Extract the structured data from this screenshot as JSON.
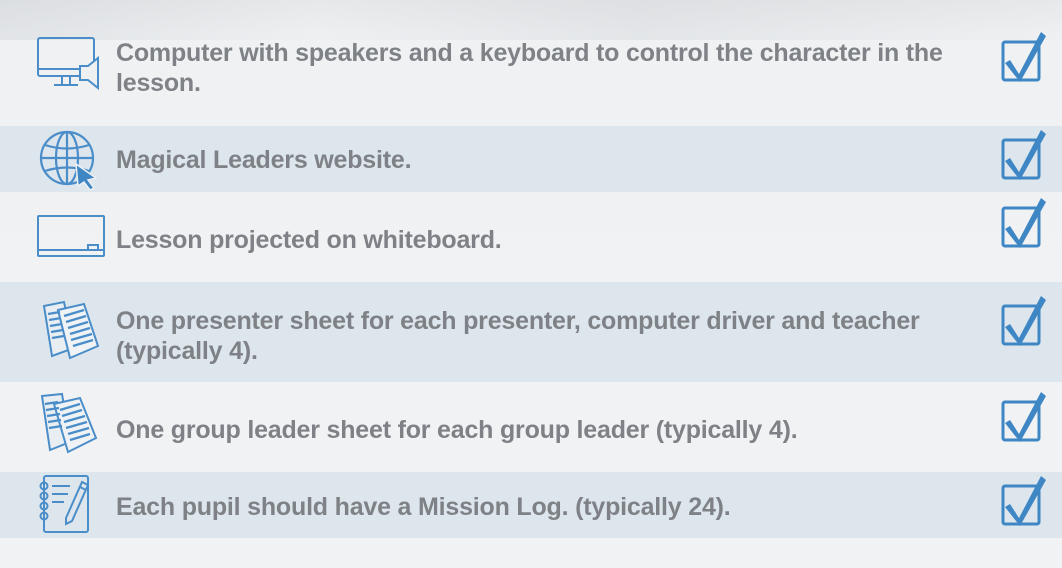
{
  "checklist": {
    "accent_color": "#3f86c4",
    "items": [
      {
        "icon": "computer-speaker-icon",
        "text": "Computer with speakers and a keyboard to control the character in the lesson.",
        "checked": true
      },
      {
        "icon": "globe-cursor-icon",
        "text": "Magical Leaders website.",
        "checked": true
      },
      {
        "icon": "whiteboard-icon",
        "text": "Lesson projected on whiteboard.",
        "checked": true
      },
      {
        "icon": "documents-icon",
        "text": "One presenter sheet for each presenter, computer driver and teacher (typically 4).",
        "checked": true
      },
      {
        "icon": "documents-icon",
        "text": "One group leader sheet for each group leader (typically 4).",
        "checked": true
      },
      {
        "icon": "notebook-pen-icon",
        "text": "Each pupil should have a Mission Log. (typically 24).",
        "checked": true
      }
    ]
  }
}
